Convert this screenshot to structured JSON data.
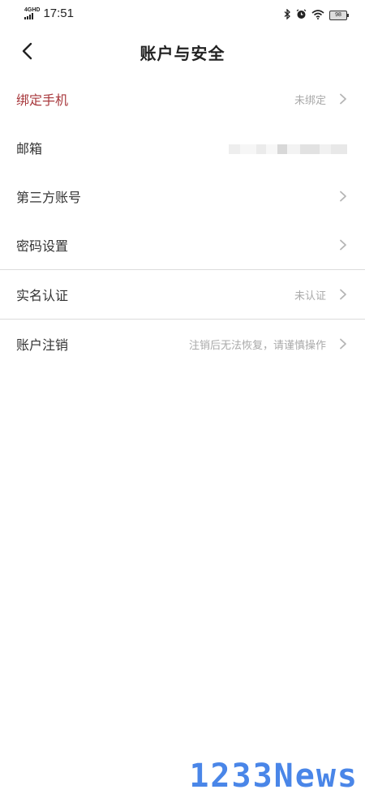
{
  "status_bar": {
    "network": "4GHD",
    "time": "17:51",
    "battery": "98"
  },
  "header": {
    "title": "账户与安全"
  },
  "rows": [
    {
      "label": "绑定手机",
      "value": "未绑定"
    },
    {
      "label": "邮箱",
      "value": ""
    },
    {
      "label": "第三方账号",
      "value": ""
    },
    {
      "label": "密码设置",
      "value": ""
    },
    {
      "label": "实名认证",
      "value": "未认证"
    },
    {
      "label": "账户注销",
      "value": "注销后无法恢复，请谨慎操作"
    }
  ],
  "colors": {
    "accent": "#a8383c",
    "secondary_text": "#a9a9a9",
    "divider": "#dcdcdc"
  },
  "watermark": "1233News"
}
